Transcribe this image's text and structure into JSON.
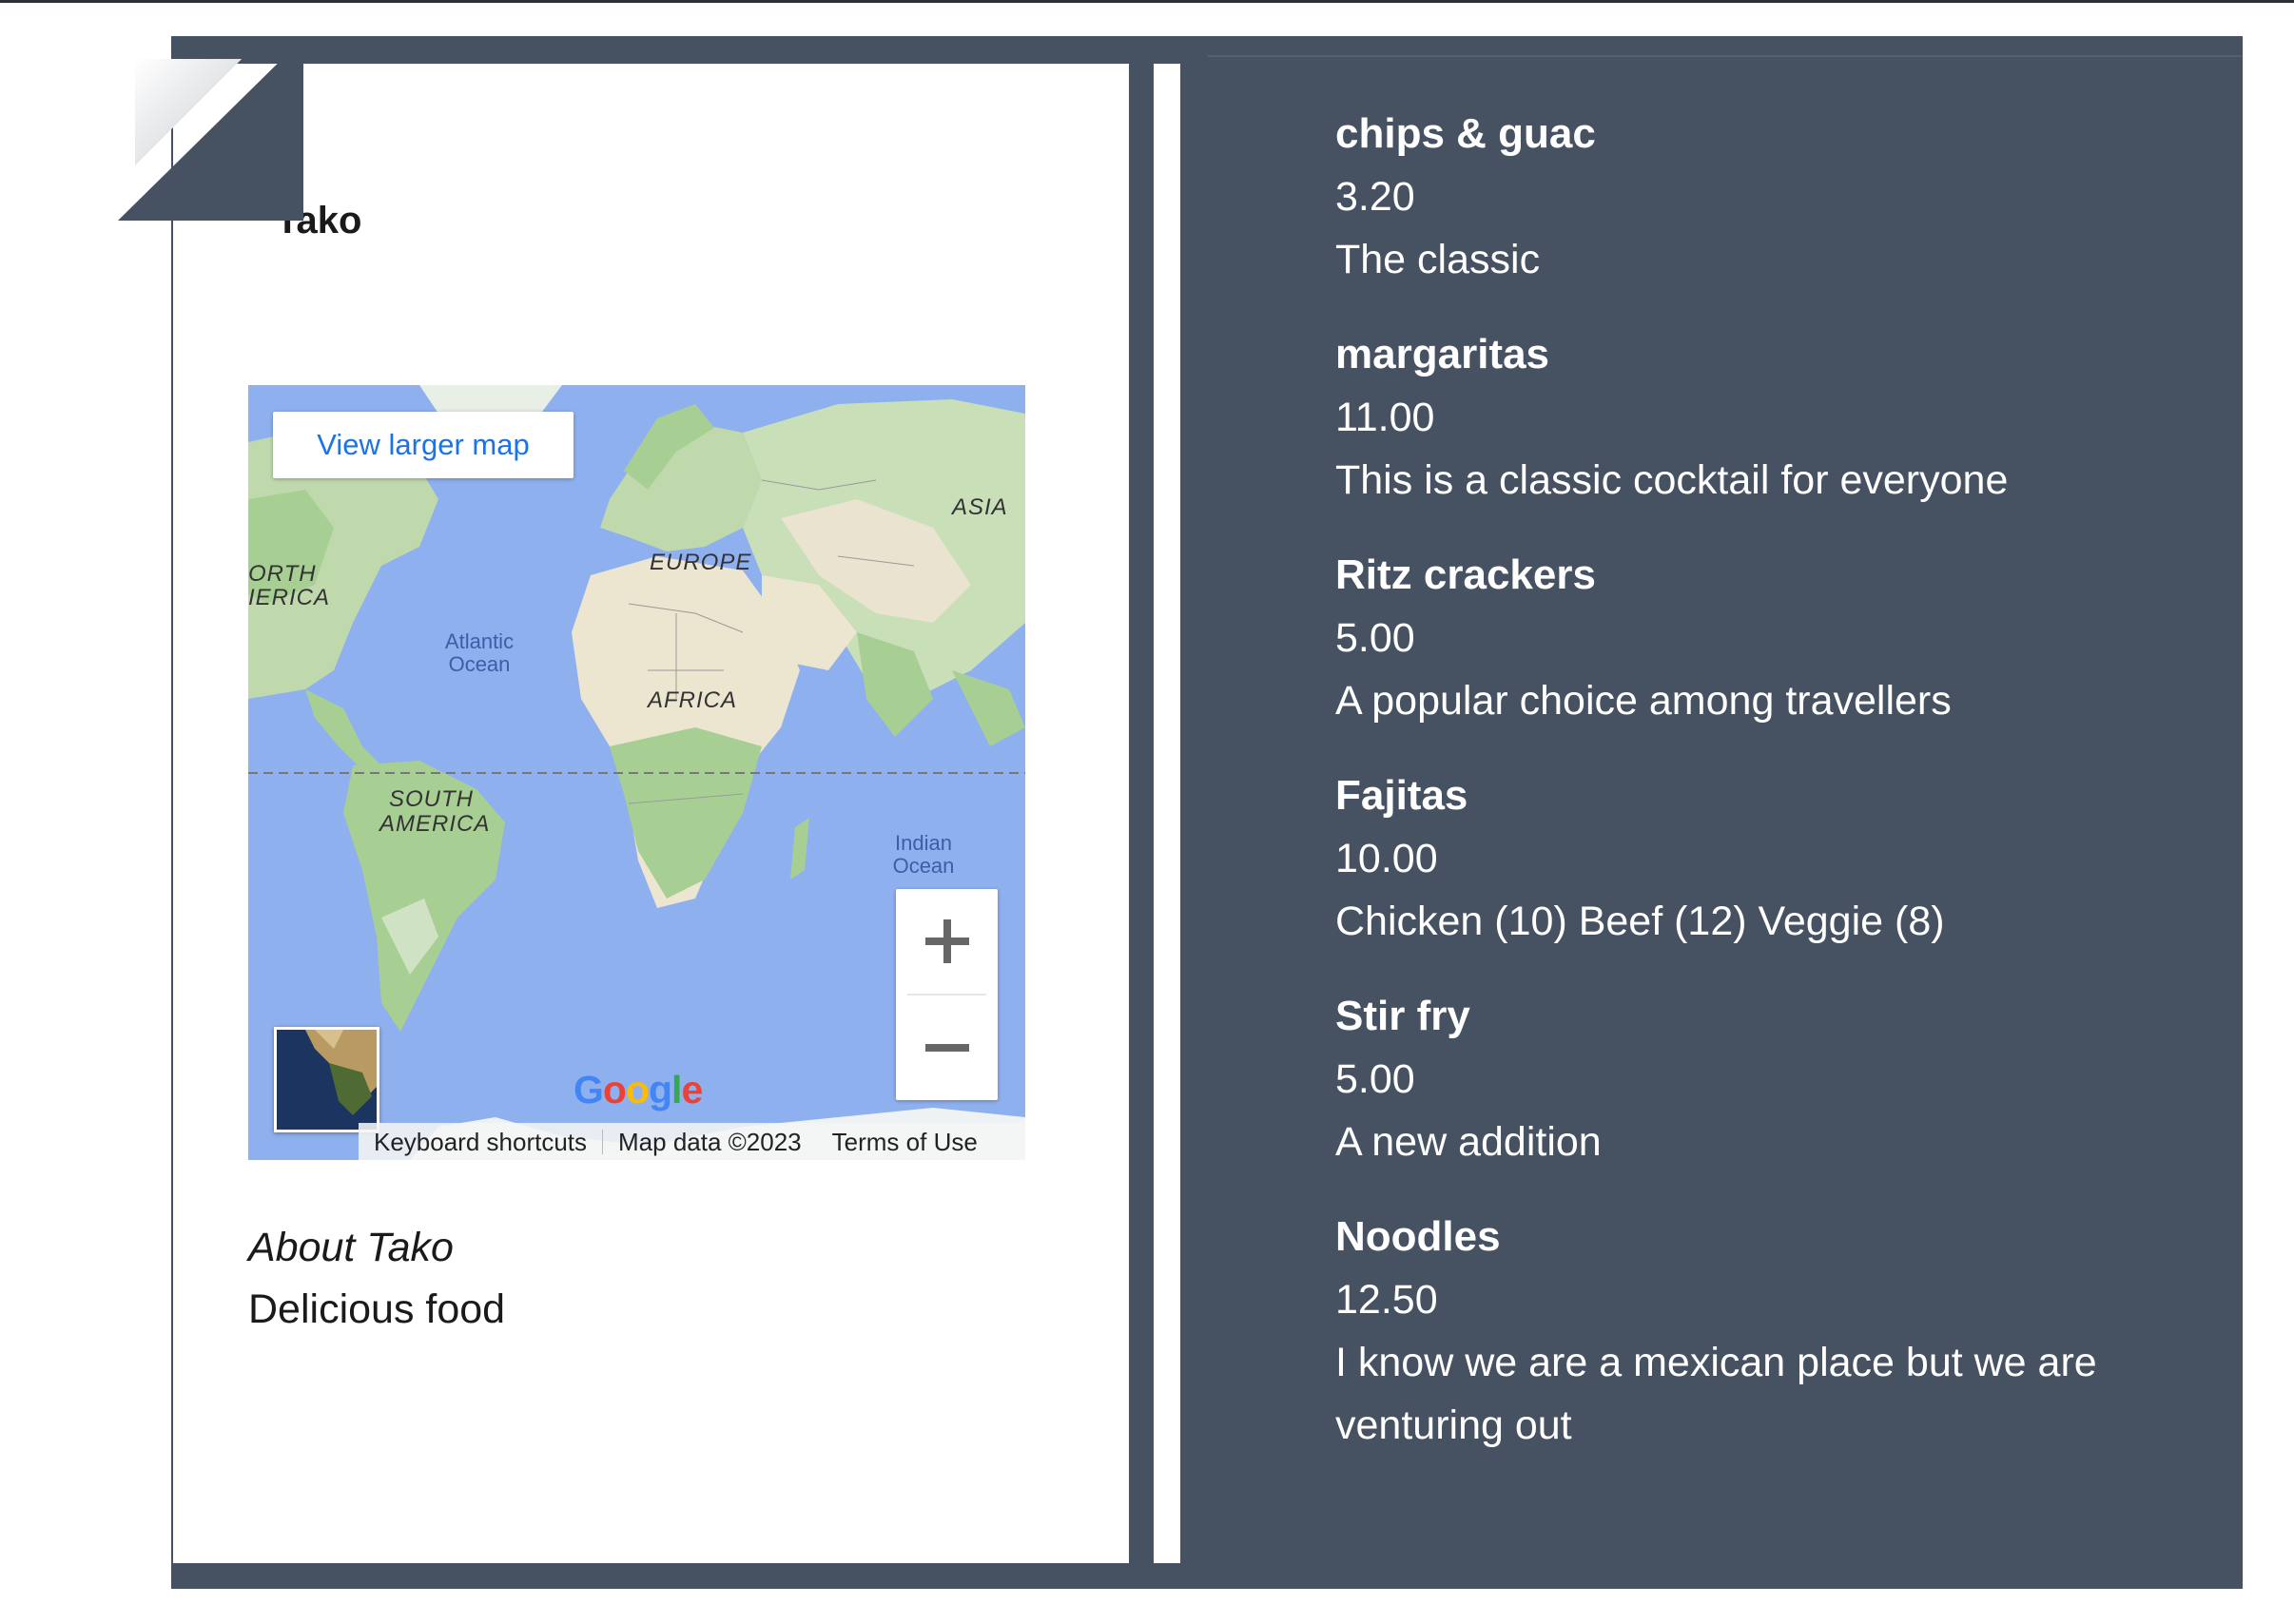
{
  "business": {
    "name": "Tako"
  },
  "map": {
    "view_larger_label": "View larger map",
    "labels": {
      "asia": "ASIA",
      "europe": "EUROPE",
      "north_america_1": "ORTH",
      "north_america_2": "IERICA",
      "atlantic_1": "Atlantic",
      "atlantic_2": "Ocean",
      "africa": "AFRICA",
      "south_america_1": "SOUTH",
      "south_america_2": "AMERICA",
      "indian_1": "Indian",
      "indian_2": "Ocean"
    },
    "zoom_in_icon": "plus-icon",
    "zoom_out_icon": "minus-icon",
    "logo_text": "Google",
    "attribution": {
      "keyboard": "Keyboard shortcuts",
      "data": "Map data ©2023",
      "terms": "Terms of Use"
    }
  },
  "about": {
    "title": "About Tako",
    "text": "Delicious food"
  },
  "menu": {
    "items": [
      {
        "name": "chips & guac",
        "price": "3.20",
        "description": "The classic"
      },
      {
        "name": "margaritas",
        "price": "11.00",
        "description": "This is a classic cocktail for everyone"
      },
      {
        "name": "Ritz crackers",
        "price": "5.00",
        "description": "A popular choice among travellers"
      },
      {
        "name": "Fajitas",
        "price": "10.00",
        "description": "Chicken (10) Beef (12) Veggie (8)"
      },
      {
        "name": "Stir fry",
        "price": "5.00",
        "description": "A new addition"
      },
      {
        "name": "Noodles",
        "price": "12.50",
        "description": "I know we are a mexican place but we are venturing out"
      }
    ]
  },
  "colors": {
    "panel": "#465262",
    "ocean": "#8fb0ef",
    "land": "#cfe3c4",
    "link": "#1a73e8"
  }
}
